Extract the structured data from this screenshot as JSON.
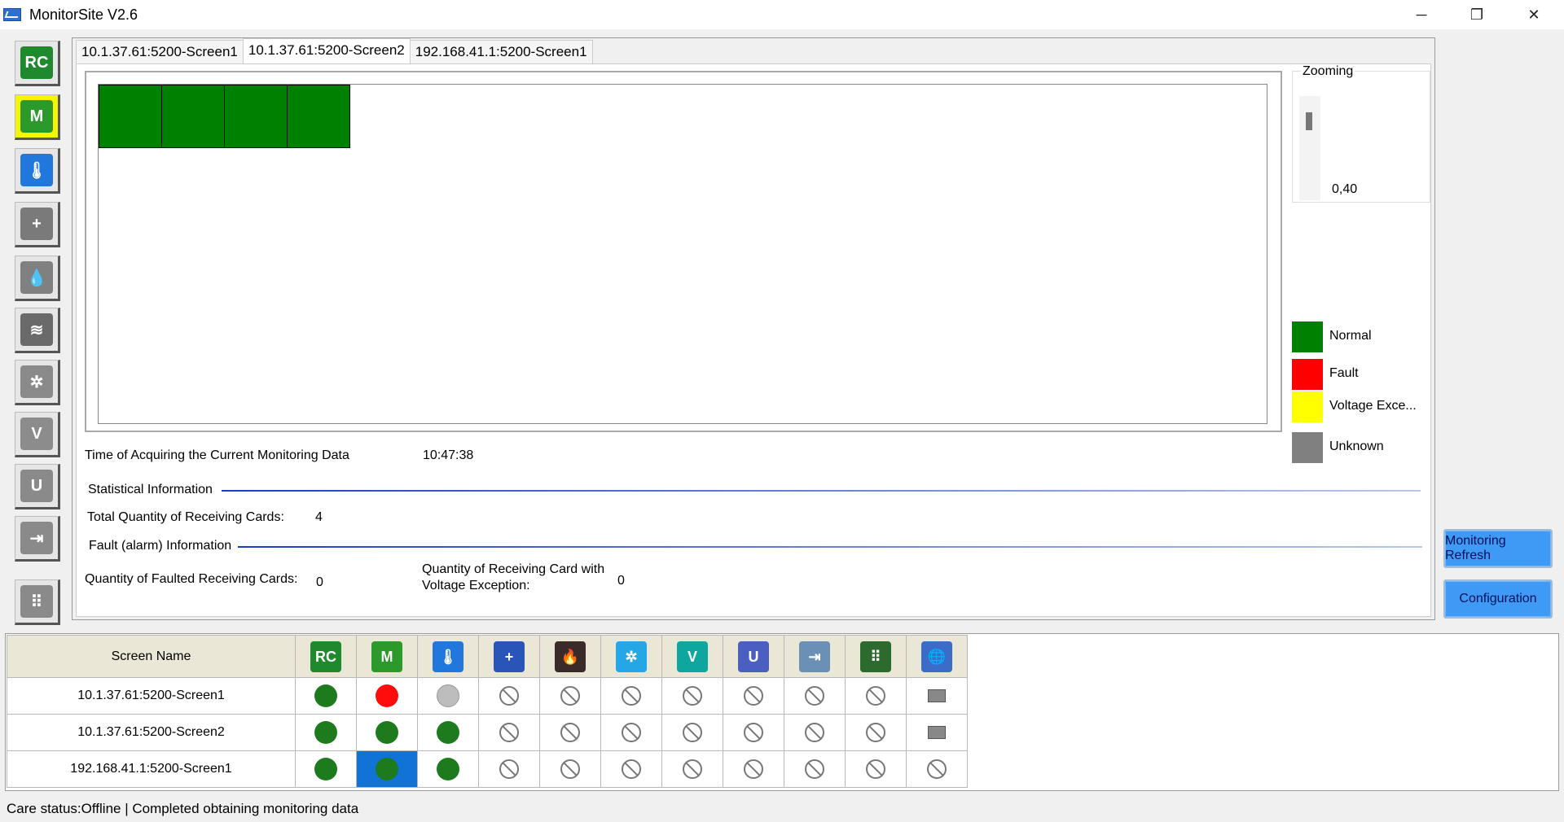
{
  "window": {
    "title": "MonitorSite V2.6",
    "minimize": "─",
    "maximize": "❐",
    "close": "✕"
  },
  "sidebar": {
    "items": [
      {
        "name": "receiving-card",
        "label": "RC",
        "color": "#1f8a2d",
        "active": false
      },
      {
        "name": "module",
        "label": "M",
        "color": "#2b9a2b",
        "active": true
      },
      {
        "name": "temperature",
        "label": "🌡",
        "color": "#2277dd",
        "active": false
      },
      {
        "name": "monitor-card",
        "label": "+",
        "color": "#7a7a7a",
        "active": false
      },
      {
        "name": "humidity",
        "label": "💧",
        "color": "#808080",
        "active": false
      },
      {
        "name": "smoke",
        "label": "≋",
        "color": "#6a6a6a",
        "active": false
      },
      {
        "name": "fan",
        "label": "✲",
        "color": "#8a8a8a",
        "active": false
      },
      {
        "name": "voltage",
        "label": "V",
        "color": "#8c8c8c",
        "active": false
      },
      {
        "name": "magnet",
        "label": "U",
        "color": "#8a8a8a",
        "active": false
      },
      {
        "name": "door",
        "label": "⇥",
        "color": "#8a8a8a",
        "active": false
      },
      {
        "name": "led-panel",
        "label": "⠿",
        "color": "#8a8a8a",
        "active": false
      }
    ]
  },
  "tabs": [
    {
      "label": "10.1.37.61:5200-Screen1",
      "active": false
    },
    {
      "label": "10.1.37.61:5200-Screen2",
      "active": true
    },
    {
      "label": "192.168.41.1:5200-Screen1",
      "active": false
    }
  ],
  "screen": {
    "cells": 4,
    "cell_status": "Normal"
  },
  "zoom": {
    "legend": "Zooming",
    "value": "0,40"
  },
  "legend": [
    {
      "label": "Normal",
      "color": "#008000"
    },
    {
      "label": "Fault",
      "color": "#ff0000"
    },
    {
      "label": "Voltage Exce...",
      "color": "#ffff00"
    },
    {
      "label": "Unknown",
      "color": "#808080"
    }
  ],
  "info": {
    "acquire_label": "Time of Acquiring the Current Monitoring Data",
    "acquire_time": "10:47:38",
    "stat_header": "Statistical Information",
    "total_label": "Total Quantity of Receiving Cards:",
    "total_value": "4",
    "fault_header": "Fault (alarm) Information",
    "faulted_label": "Quantity of Faulted Receiving Cards:",
    "faulted_value": "0",
    "voltage_label_1": "Quantity of Receiving Card with",
    "voltage_label_2": "Voltage Exception:",
    "voltage_value": "0"
  },
  "buttons": {
    "refresh": "Monitoring Refresh",
    "config": "Configuration"
  },
  "table": {
    "header_name": "Screen Name",
    "columns": [
      {
        "name": "receiving-card",
        "label": "RC",
        "color": "#1f8a2d"
      },
      {
        "name": "module",
        "label": "M",
        "color": "#2b9a2b"
      },
      {
        "name": "temperature",
        "label": "🌡",
        "color": "#2277dd"
      },
      {
        "name": "monitor-card",
        "label": "+",
        "color": "#2a55b8"
      },
      {
        "name": "smoke",
        "label": "🔥",
        "color": "#3a2a2a"
      },
      {
        "name": "fan",
        "label": "✲",
        "color": "#25a6e6"
      },
      {
        "name": "voltage",
        "label": "V",
        "color": "#0fa6a0"
      },
      {
        "name": "magnet",
        "label": "U",
        "color": "#4a5fc0"
      },
      {
        "name": "door",
        "label": "⇥",
        "color": "#6b8fb5"
      },
      {
        "name": "led-panel",
        "label": "⠿",
        "color": "#2d6a2d"
      },
      {
        "name": "network",
        "label": "🌐",
        "color": "#3a6cc8"
      }
    ],
    "rows": [
      {
        "name": "10.1.37.61:5200-Screen1",
        "cells": [
          "green",
          "red",
          "gray",
          "na",
          "na",
          "na",
          "na",
          "na",
          "na",
          "na",
          "mon"
        ],
        "selected": -1
      },
      {
        "name": "10.1.37.61:5200-Screen2",
        "cells": [
          "green",
          "green",
          "green",
          "na",
          "na",
          "na",
          "na",
          "na",
          "na",
          "na",
          "mon"
        ],
        "selected": -1
      },
      {
        "name": "192.168.41.1:5200-Screen1",
        "cells": [
          "green",
          "green",
          "green",
          "na",
          "na",
          "na",
          "na",
          "na",
          "na",
          "na",
          "na"
        ],
        "selected": 1
      }
    ]
  },
  "status": {
    "text": "Care status:Offline  |  Completed obtaining monitoring data"
  }
}
